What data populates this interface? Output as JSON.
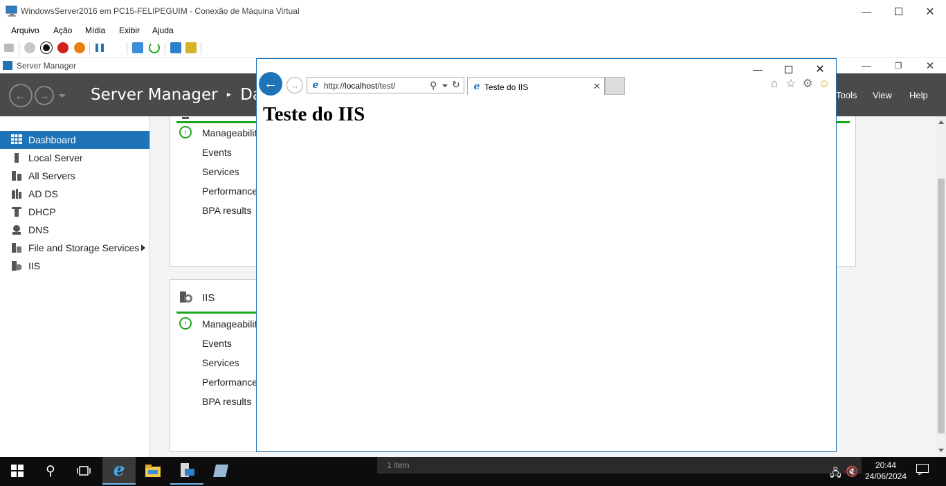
{
  "vm_window": {
    "title": "WindowsServer2016 em PC15-FELIPEGUIM - Conexão de Máquina Virtual",
    "menu": [
      "Arquivo",
      "Ação",
      "Mídia",
      "Exibir",
      "Ajuda"
    ],
    "toolbar_icons": [
      "ctrl-alt-del-icon",
      "start-icon",
      "turn-off-icon",
      "shutdown-icon",
      "power-icon",
      "pause-icon",
      "resume-icon",
      "checkpoint-icon",
      "revert-icon",
      "enhanced-session-icon",
      "share-icon"
    ]
  },
  "server_manager": {
    "window_title": "Server Manager",
    "breadcrumb_app": "Server Manager",
    "breadcrumb_page": "Dashb",
    "header_menu": [
      "Tools",
      "View",
      "Help"
    ],
    "sidebar": [
      {
        "label": "Dashboard",
        "icon": "dashboard-icon",
        "active": true
      },
      {
        "label": "Local Server",
        "icon": "server-icon"
      },
      {
        "label": "All Servers",
        "icon": "servers-icon"
      },
      {
        "label": "AD DS",
        "icon": "adds-icon"
      },
      {
        "label": "DHCP",
        "icon": "dhcp-icon"
      },
      {
        "label": "DNS",
        "icon": "dns-icon"
      },
      {
        "label": "File and Storage Services",
        "icon": "file-storage-icon"
      },
      {
        "label": "IIS",
        "icon": "iis-icon"
      }
    ],
    "panel_top": {
      "rows": [
        "Manageabilit",
        "Events",
        "Services",
        "Performance",
        "BPA results"
      ]
    },
    "panel_iis": {
      "title": "IIS",
      "rows": [
        "Manageabilit",
        "Events",
        "Services",
        "Performance",
        "BPA results"
      ]
    }
  },
  "browser": {
    "url_prefix": "http://",
    "url_host": "localhost",
    "url_path": "/test/",
    "tab_title": "Teste do IIS",
    "page_heading": "Teste do IIS"
  },
  "taskbar": {
    "status_text": "1 item",
    "time": "20:44",
    "date": "24/06/2024"
  },
  "colors": {
    "accent": "#1f73b7",
    "ok_green": "#17a81a",
    "header_dark": "#4a4a4a"
  }
}
